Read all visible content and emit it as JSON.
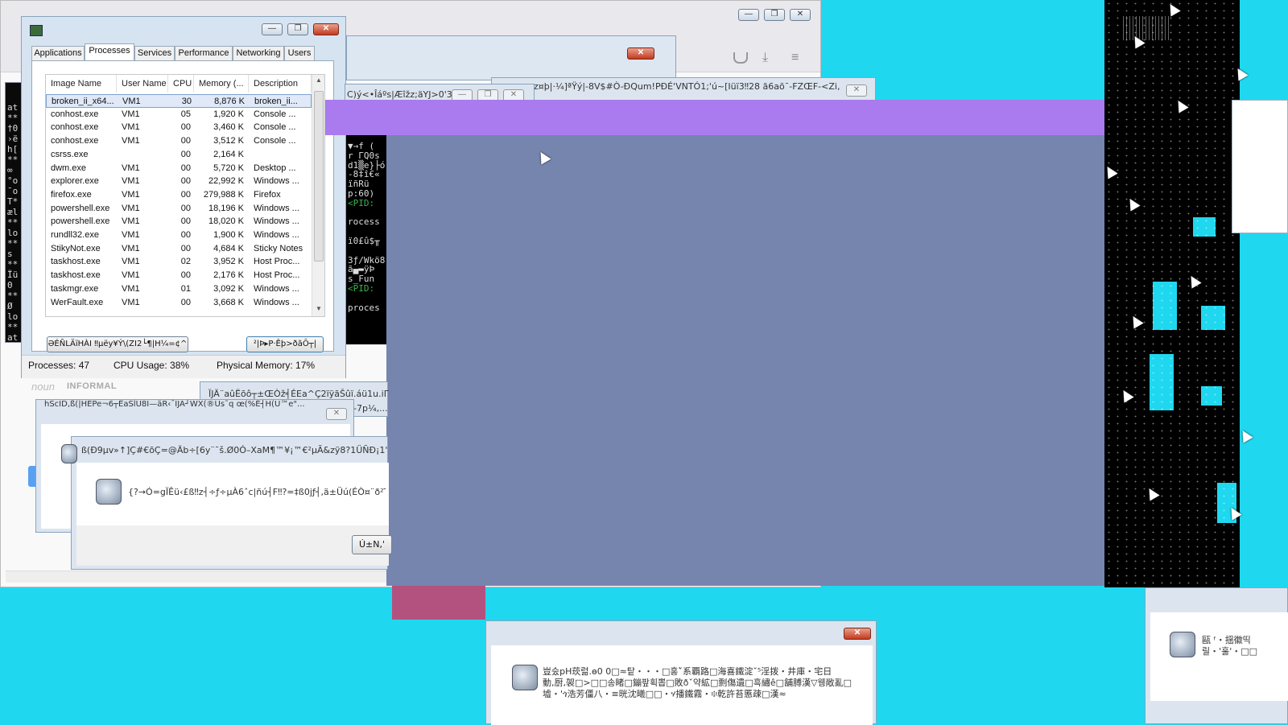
{
  "taskmgr": {
    "tabs": [
      "Applications",
      "Processes",
      "Services",
      "Performance",
      "Networking",
      "Users"
    ],
    "columns": [
      "Image Name",
      "User Name",
      "CPU",
      "Memory (...",
      "Description"
    ],
    "rows": [
      [
        "broken_ii_x64...",
        "VM1",
        "30",
        "8,876 K",
        "broken_ii..."
      ],
      [
        "conhost.exe",
        "VM1",
        "05",
        "1,920 K",
        "Console ..."
      ],
      [
        "conhost.exe",
        "VM1",
        "00",
        "3,460 K",
        "Console ..."
      ],
      [
        "conhost.exe",
        "VM1",
        "00",
        "3,512 K",
        "Console ..."
      ],
      [
        "csrss.exe",
        "",
        "00",
        "2,164 K",
        ""
      ],
      [
        "dwm.exe",
        "VM1",
        "00",
        "5,720 K",
        "Desktop ..."
      ],
      [
        "explorer.exe",
        "VM1",
        "00",
        "22,992 K",
        "Windows ..."
      ],
      [
        "firefox.exe",
        "VM1",
        "00",
        "279,988 K",
        "Firefox"
      ],
      [
        "powershell.exe",
        "VM1",
        "00",
        "18,196 K",
        "Windows ..."
      ],
      [
        "powershell.exe",
        "VM1",
        "00",
        "18,020 K",
        "Windows ..."
      ],
      [
        "rundll32.exe",
        "VM1",
        "00",
        "1,900 K",
        "Windows ..."
      ],
      [
        "StikyNot.exe",
        "VM1",
        "00",
        "4,684 K",
        "Sticky Notes"
      ],
      [
        "taskhost.exe",
        "VM1",
        "02",
        "3,952 K",
        "Host Proc..."
      ],
      [
        "taskhost.exe",
        "VM1",
        "00",
        "2,176 K",
        "Host Proc..."
      ],
      [
        "taskmgr.exe",
        "VM1",
        "01",
        "3,092 K",
        "Windows ..."
      ],
      [
        "WerFault.exe",
        "VM1",
        "00",
        "3,668 K",
        "Windows ..."
      ]
    ],
    "btn_left": "ƏÉÑLÄïHÀI ‼µëy¥Ý\\(ZI2└¶|H¼=¢^",
    "btn_right": "²|Þ▸P·Êþ>ðãÔ┬|",
    "status_processes": "Processes: 47",
    "status_cpu": "CPU Usage: 38%",
    "status_memory": "Physical Memory: 17%"
  },
  "garbled": {
    "win_b_title": "z¤þ|·¼]ªŸý|-8V$#Ò-ÐQum!PÐÉ'VNTÓ1;'ú~[Iüï3‼28 ã6aõ¯-FZŒF-<Zi,õ...",
    "win_c_title": "C)ý<•Îáºs|Æîžz;äYJ>0'3",
    "console_lines": [
      "▼→f (",
      "r ΓQ0s",
      "d1▒e}├ó",
      "-8‡î€«",
      "ïñRü",
      "p:60)",
      "<PID:",
      "",
      "rocess",
      "",
      "ï0£û$╥",
      "",
      "3ƒ/Wkö8",
      "ã▄▬ÿÞ",
      "s_Fun",
      "<PID:",
      "",
      "proces"
    ],
    "dict_noun": "noun",
    "dict_informal": "INFORMAL",
    "win_d_title": "ÏJÄ¨aûËõô┬±ŒÒž╡ÉEa^Ç2ïÿãŠûï.áü1u.iΓ€x",
    "win_d_sub": "-7p¼,...",
    "win_e_title": "hScID,ß(|HEPe¬6┬ÊaSlU8I—äR‹ˉIJA┘WX(®Ùs˜q œ(%È┤H(Ü™e\"...",
    "win_f_title": "ß(Ð9µv»↑]Ç#€õÇ=@Äb÷[6y¨¯š.Ø0Ó–XaM¶™¥¡™€²µÃ&zÿ8?1ÜÑÐ¡1'lµCYÞ~",
    "win_f_msg": "{?→Ó=gÏÊü‹£ß‼z┤÷ƒ÷µÀ6ˆc|ñú┤F‼?=‡ß0jƒ┤,ä±Üú(ÉÒ¤¨ð²TÕ8→",
    "win_f_btn": "Ú±N,'",
    "bottom_msg_1": "豈숬pH莰럶.ɵ0 0□≈탙・・・□홍ˇ፞系覇路□海喜鐵淀ˇ⁵淫拨・井庫・宅日",
    "bottom_msg_2": "動,厨,袈□>□□송睹□鏰팦획뽑□敗ðˇ약絋□剽傷遺□흑繡ê□舗膊漢▽웽敞亂□",
    "bottom_msg_3": "墟・'ጎ浩芳僵八・≡晄沈曦□□・ሃ播鐵霧・፨乾許苔慝疎□漢≈",
    "right_msg_1": "甌 ᶠ・揺徽띡",
    "right_msg_2": "릴・'훌'・□□"
  },
  "colors": {
    "desktop": "#1fd8ef",
    "purple_bar": "#a97bef",
    "slate_panel": "#7585ae",
    "pink_block": "#b4527f"
  }
}
